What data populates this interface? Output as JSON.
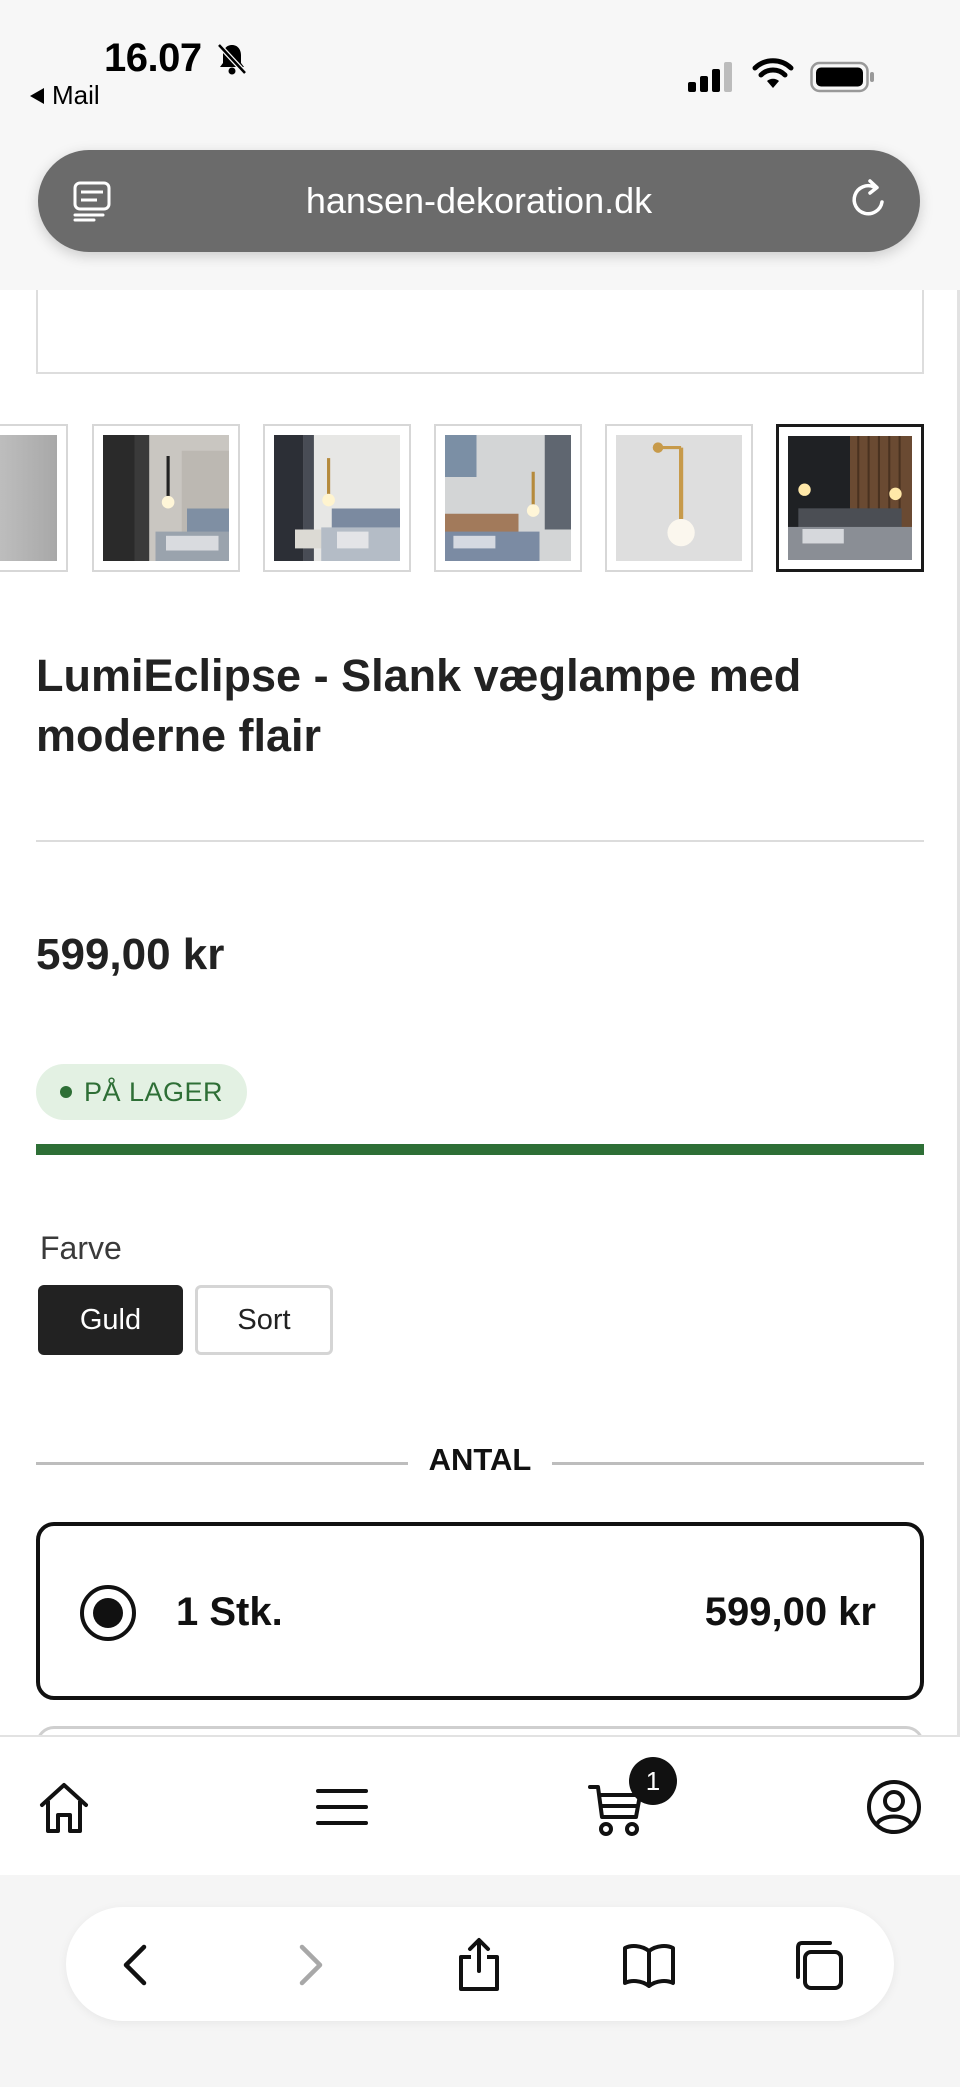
{
  "status_bar": {
    "time": "16.07",
    "back_app": "Mail",
    "icons": [
      "bell-slash-icon",
      "cellular-signal-icon",
      "wifi-icon",
      "battery-icon"
    ]
  },
  "browser": {
    "url": "hansen-dekoration.dk",
    "icons": [
      "reader-mode-icon",
      "reload-icon"
    ]
  },
  "product": {
    "thumbnails": [
      {
        "name": "thumb-partial"
      },
      {
        "name": "thumb-1"
      },
      {
        "name": "thumb-2"
      },
      {
        "name": "thumb-3"
      },
      {
        "name": "thumb-4"
      },
      {
        "name": "thumb-5",
        "selected": true
      }
    ],
    "title": "LumiEclipse - Slank væglampe med moderne flair",
    "price": "599,00 kr",
    "stock_status": "PÅ LAGER",
    "stock_color": "#2e6f36",
    "variant": {
      "label": "Farve",
      "options": [
        "Guld",
        "Sort"
      ],
      "selected": "Guld"
    },
    "quantity": {
      "heading": "ANTAL",
      "options": [
        {
          "label": "1 Stk.",
          "price": "599,00 kr",
          "selected": true
        }
      ]
    }
  },
  "store_nav": {
    "items": [
      "home-icon",
      "menu-icon",
      "cart-icon",
      "account-icon"
    ],
    "cart_count": "1"
  },
  "safari_toolbar": {
    "items": [
      "back-icon",
      "forward-icon",
      "share-icon",
      "bookmarks-icon",
      "tabs-icon"
    ]
  }
}
